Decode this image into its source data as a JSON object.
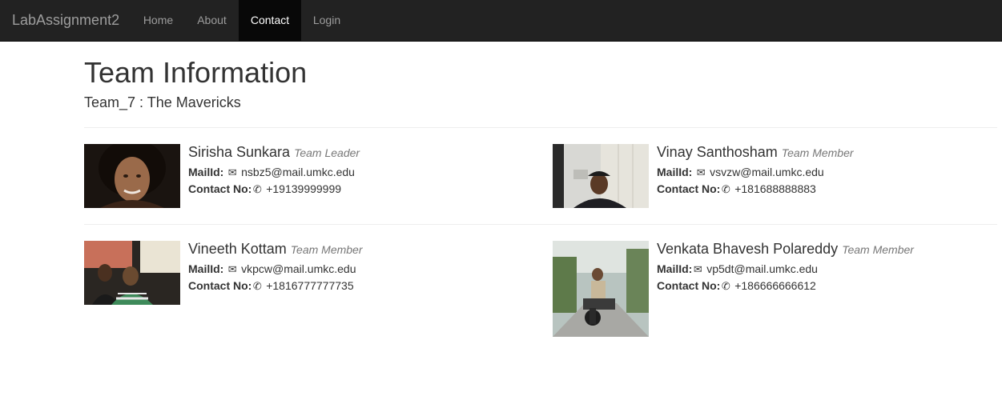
{
  "navbar": {
    "brand": "LabAssignment2",
    "items": [
      {
        "label": "Home",
        "active": false
      },
      {
        "label": "About",
        "active": false
      },
      {
        "label": "Contact",
        "active": true
      },
      {
        "label": "Login",
        "active": false
      }
    ]
  },
  "page": {
    "title": "Team Information",
    "team": "Team_7 : The Mavericks"
  },
  "labels": {
    "mail_id": "MailId:",
    "contact_no": "Contact No:"
  },
  "members": [
    {
      "name": "Sirisha Sunkara",
      "role": "Team Leader",
      "email": "nsbz5@mail.umkc.edu",
      "phone": "+19139999999"
    },
    {
      "name": "Vinay Santhosham",
      "role": "Team Member",
      "email": "vsvzw@mail.umkc.edu",
      "phone": "+181688888883"
    },
    {
      "name": "Vineeth Kottam",
      "role": "Team Member",
      "email": "vkpcw@mail.umkc.edu",
      "phone": "+1816777777735"
    },
    {
      "name": "Venkata Bhavesh Polareddy",
      "role": "Team Member",
      "email": "vp5dt@mail.umkc.edu",
      "phone": "+186666666612"
    }
  ],
  "icons": {
    "mail": "envelope-icon",
    "phone": "phone-icon"
  },
  "colors": {
    "navbar_bg": "#222222",
    "navbar_active_bg": "#080808",
    "nav_text": "#9d9d9d",
    "role_text": "#777777"
  }
}
